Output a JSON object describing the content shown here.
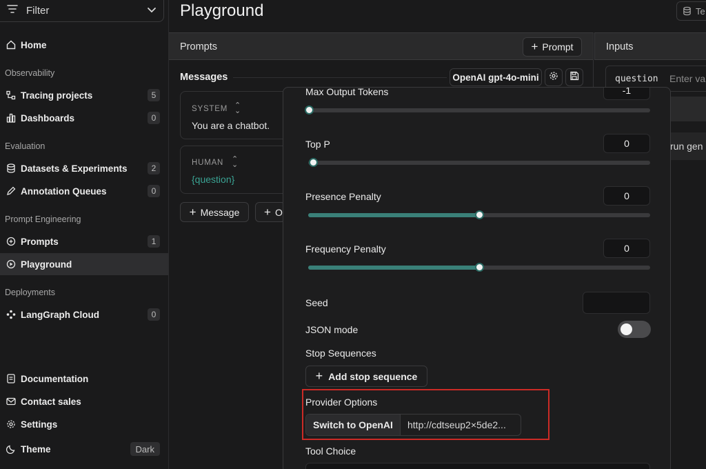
{
  "sidebar": {
    "filter_label": "Filter",
    "items": {
      "home": "Home",
      "tracing": "Tracing projects",
      "tracing_count": "5",
      "dashboards": "Dashboards",
      "dashboards_count": "0",
      "datasets": "Datasets & Experiments",
      "datasets_count": "2",
      "annotation": "Annotation Queues",
      "annotation_count": "0",
      "prompts": "Prompts",
      "prompts_count": "1",
      "playground": "Playground",
      "langgraph": "LangGraph Cloud",
      "langgraph_count": "0",
      "documentation": "Documentation",
      "contact": "Contact sales",
      "settings": "Settings",
      "theme": "Theme",
      "theme_value": "Dark"
    },
    "sections": {
      "observability": "Observability",
      "evaluation": "Evaluation",
      "prompt_engineering": "Prompt Engineering",
      "deployments": "Deployments"
    }
  },
  "main": {
    "title": "Playground",
    "topright_label": "Te",
    "prompts_header": "Prompts",
    "add_prompt": "Prompt",
    "inputs_header": "Inputs",
    "messages_label": "Messages",
    "model_label": "OpenAI gpt-4o-mini",
    "messages": [
      {
        "role": "SYSTEM",
        "text": "You are a chatbot."
      },
      {
        "role": "HUMAN",
        "text": "{question}"
      }
    ],
    "add_message": "Message",
    "add_other": "O",
    "input_key": "question",
    "input_placeholder": "Enter va",
    "run_label": "run gen"
  },
  "settings_popover": {
    "max_tokens_label": "Max Output Tokens",
    "max_tokens_value": "-1",
    "top_p_label": "Top P",
    "top_p_value": "0",
    "top_p_fraction": 0.0,
    "presence_label": "Presence Penalty",
    "presence_value": "0",
    "presence_fraction": 0.5,
    "frequency_label": "Frequency Penalty",
    "frequency_value": "0",
    "frequency_fraction": 0.5,
    "seed_label": "Seed",
    "json_mode_label": "JSON mode",
    "json_mode_on": false,
    "stop_sequences_label": "Stop Sequences",
    "add_stop_label": "Add stop sequence",
    "provider_options_label": "Provider Options",
    "switch_label": "Switch to OpenAI",
    "provider_url": "http://cdtseup2×5de2...",
    "tool_choice_label": "Tool Choice"
  },
  "colors": {
    "accent_teal": "#3a8078",
    "highlight_red": "#cc2b26",
    "background": "#1a1a1b"
  }
}
